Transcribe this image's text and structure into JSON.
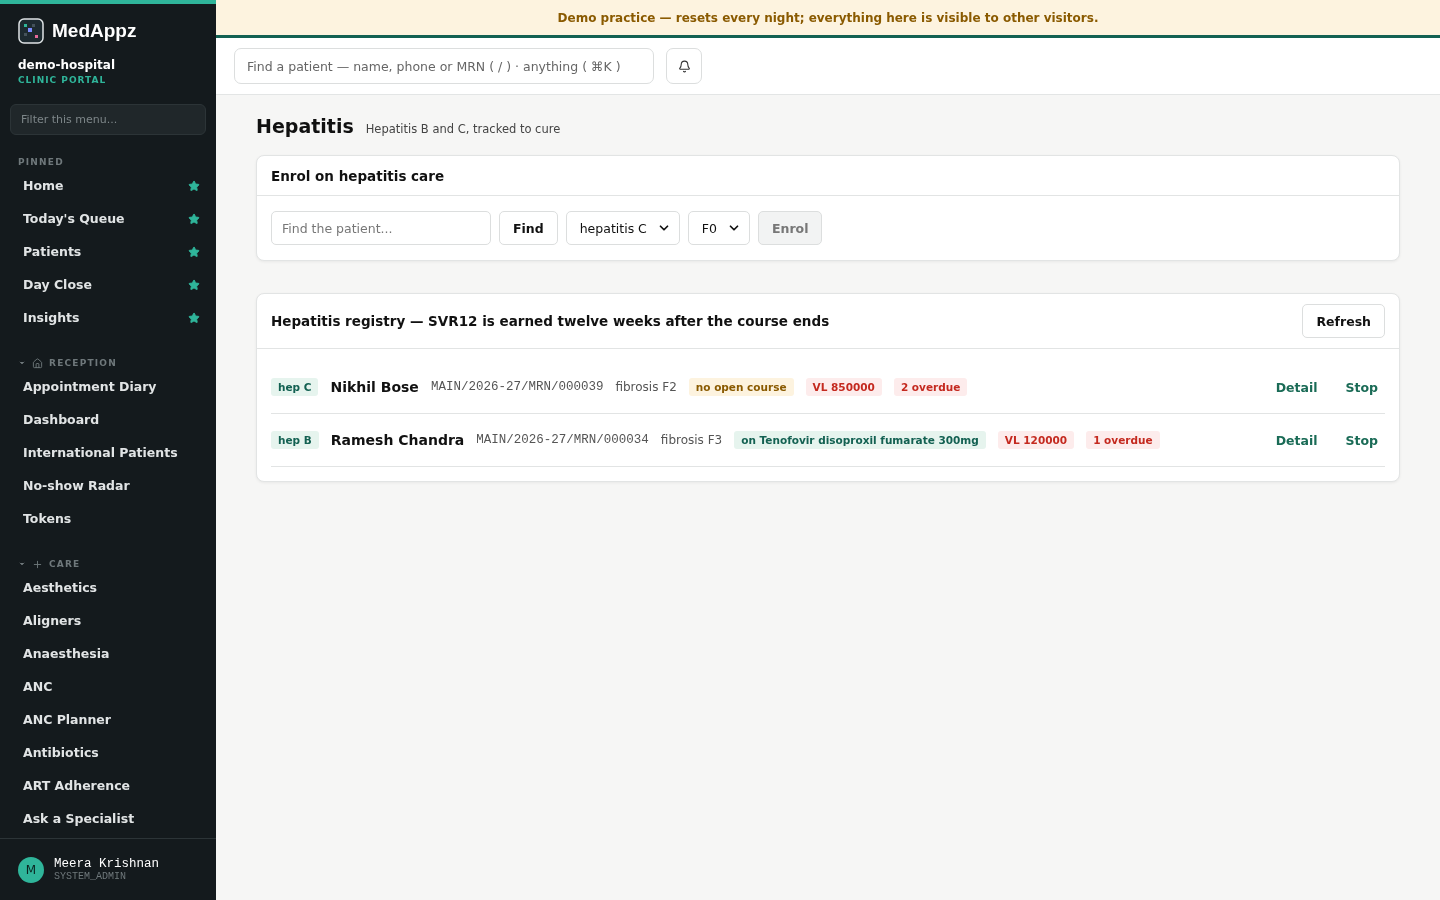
{
  "banner": "Demo practice — resets every night; everything here is visible to other visitors.",
  "sidebar": {
    "brand": "MedAppz",
    "org": "demo-hospital",
    "portal": "CLINIC PORTAL",
    "filter_placeholder": "Filter this menu...",
    "pinned": {
      "title": "PINNED",
      "items": [
        {
          "label": "Home",
          "starred": true
        },
        {
          "label": "Today's Queue",
          "starred": true
        },
        {
          "label": "Patients",
          "starred": true
        },
        {
          "label": "Day Close",
          "starred": true
        },
        {
          "label": "Insights",
          "starred": true
        }
      ]
    },
    "groups": [
      {
        "title": "RECEPTION",
        "kind": "house",
        "expanded": true,
        "items": [
          "Appointment Diary",
          "Dashboard",
          "International Patients",
          "No-show Radar",
          "Tokens"
        ]
      },
      {
        "title": "CARE",
        "kind": "plus",
        "expanded": true,
        "items": [
          "Aesthetics",
          "Aligners",
          "Anaesthesia",
          "ANC",
          "ANC Planner",
          "Antibiotics",
          "ART Adherence",
          "Ask a Specialist"
        ]
      }
    ],
    "user": {
      "initial": "M",
      "name": "Meera Krishnan",
      "role": "SYSTEM_ADMIN"
    }
  },
  "topbar": {
    "search_placeholder": "Find a patient — name, phone or MRN ( / ) · anything ( ⌘K )"
  },
  "page": {
    "title": "Hepatitis",
    "subtitle": "Hepatitis B and C, tracked to cure"
  },
  "enrol": {
    "title": "Enrol on hepatitis care",
    "patient_placeholder": "Find the patient...",
    "find": "Find",
    "type": "hepatitis C",
    "stage": "F0",
    "enrol": "Enrol",
    "enrol_disabled": true
  },
  "registry": {
    "title": "Hepatitis registry — SVR12 is earned twelve weeks after the course ends",
    "refresh": "Refresh",
    "rows": [
      {
        "type": "hep C",
        "name": "Nikhil Bose",
        "mrn": "MAIN/2026-27/MRN/000039",
        "fibrosis": "fibrosis F2",
        "tags": [
          {
            "text": "no open course",
            "kind": "warn"
          },
          {
            "text": "VL 850000",
            "kind": "danger"
          },
          {
            "text": "2 overdue",
            "kind": "danger"
          }
        ],
        "actions": [
          "Detail",
          "Stop"
        ]
      },
      {
        "type": "hep B",
        "name": "Ramesh Chandra",
        "mrn": "MAIN/2026-27/MRN/000034",
        "fibrosis": "fibrosis F3",
        "tags": [
          {
            "text": "on Tenofovir disoproxil fumarate 300mg",
            "kind": "ok"
          },
          {
            "text": "VL 120000",
            "kind": "danger"
          },
          {
            "text": "1 overdue",
            "kind": "danger"
          }
        ],
        "actions": [
          "Detail",
          "Stop"
        ]
      }
    ]
  }
}
